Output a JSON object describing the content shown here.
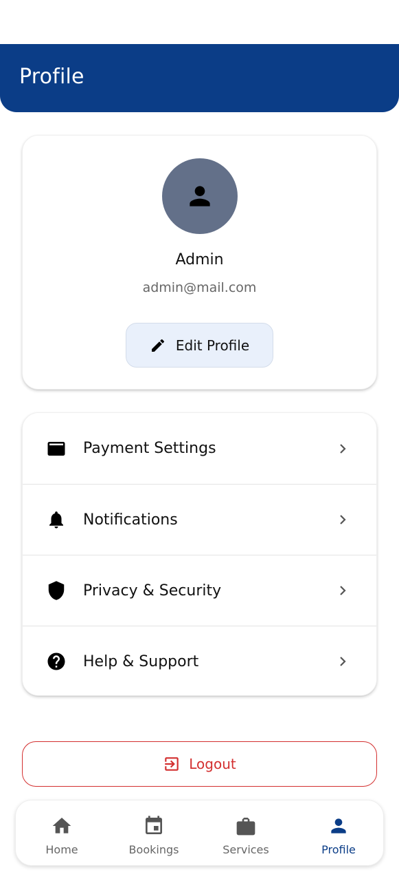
{
  "app_bar": {
    "title": "Profile"
  },
  "profile": {
    "name": "Admin",
    "email": "admin@mail.com",
    "edit_label": "Edit Profile",
    "avatar_color": "#637089"
  },
  "menu": {
    "items": [
      {
        "label": "Payment Settings",
        "icon": "credit-card-icon"
      },
      {
        "label": "Notifications",
        "icon": "bell-icon"
      },
      {
        "label": "Privacy & Security",
        "icon": "shield-icon"
      },
      {
        "label": "Help & Support",
        "icon": "help-circle-icon"
      }
    ]
  },
  "logout": {
    "label": "Logout",
    "color": "#d32f2f"
  },
  "bottom_nav": {
    "items": [
      {
        "label": "Home",
        "icon": "home-icon",
        "active": false
      },
      {
        "label": "Bookings",
        "icon": "calendar-icon",
        "active": false
      },
      {
        "label": "Services",
        "icon": "briefcase-icon",
        "active": false
      },
      {
        "label": "Profile",
        "icon": "person-icon",
        "active": true
      }
    ]
  },
  "colors": {
    "primary": "#0b3d87",
    "accent_bg": "#e9f0fb"
  }
}
